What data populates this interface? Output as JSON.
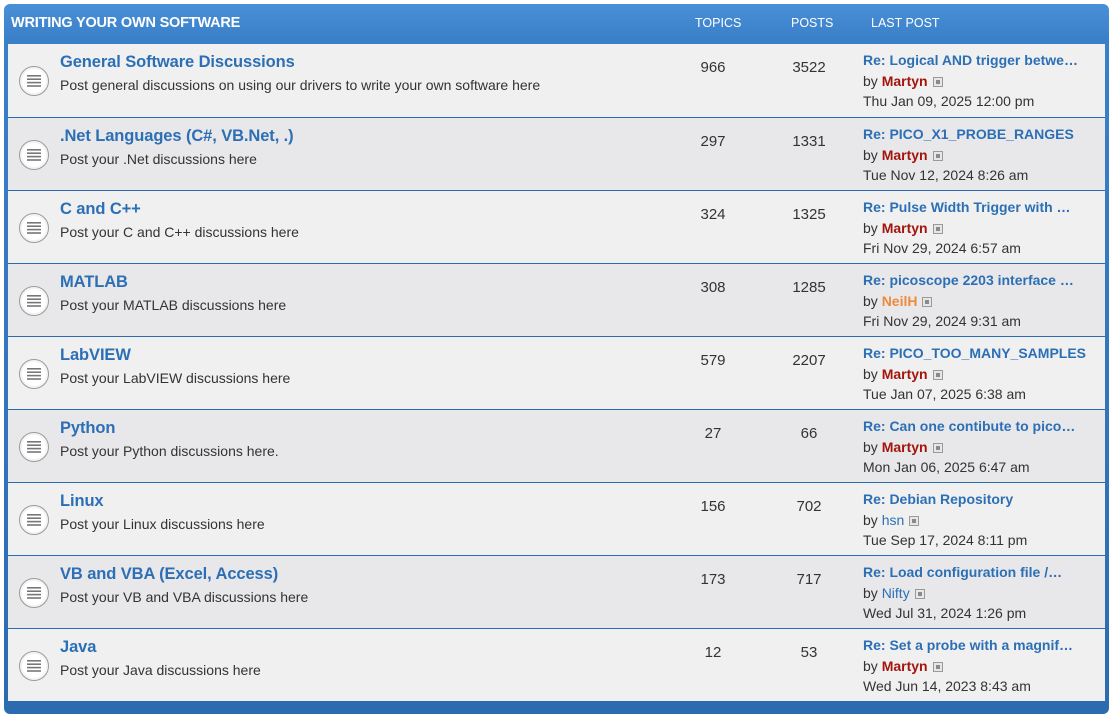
{
  "header": {
    "title": "WRITING YOUR OWN SOFTWARE",
    "topics_label": "TOPICS",
    "posts_label": "POSTS",
    "last_post_label": "LAST POST"
  },
  "colors": {
    "header_blue": "#3a80c8",
    "link_blue": "#2c6fb5",
    "user_red": "#a3150c",
    "user_orange": "#ef8a3a"
  },
  "icons": {
    "forum": "forum-read-icon",
    "view_post": "view-latest-post-icon"
  },
  "forums": [
    {
      "title": "General Software Discussions",
      "description": "Post general discussions on using our drivers to write your own software here",
      "topics": "966",
      "posts": "3522",
      "last_post": {
        "title": "Re: Logical AND trigger betwe…",
        "by": "by",
        "user": "Martyn",
        "user_color": "#a3150c",
        "time": "Thu Jan 09, 2025 12:00 pm"
      }
    },
    {
      "title": ".Net Languages (C#, VB.Net, .)",
      "description": "Post your .Net discussions here",
      "topics": "297",
      "posts": "1331",
      "last_post": {
        "title": "Re: PICO_X1_PROBE_RANGES",
        "by": "by",
        "user": "Martyn",
        "user_color": "#a3150c",
        "time": "Tue Nov 12, 2024 8:26 am"
      }
    },
    {
      "title": "C and C++",
      "description": "Post your C and C++ discussions here",
      "topics": "324",
      "posts": "1325",
      "last_post": {
        "title": "Re: Pulse Width Trigger with …",
        "by": "by",
        "user": "Martyn",
        "user_color": "#a3150c",
        "time": "Fri Nov 29, 2024 6:57 am"
      }
    },
    {
      "title": "MATLAB",
      "description": "Post your MATLAB discussions here",
      "topics": "308",
      "posts": "1285",
      "last_post": {
        "title": "Re: picoscope 2203 interface …",
        "by": "by",
        "user": "NeilH",
        "user_color": "#ef8a3a",
        "time": "Fri Nov 29, 2024 9:31 am"
      }
    },
    {
      "title": "LabVIEW",
      "description": "Post your LabVIEW discussions here",
      "topics": "579",
      "posts": "2207",
      "last_post": {
        "title": "Re: PICO_TOO_MANY_SAMPLES",
        "by": "by",
        "user": "Martyn",
        "user_color": "#a3150c",
        "time": "Tue Jan 07, 2025 6:38 am"
      }
    },
    {
      "title": "Python",
      "description": "Post your Python discussions here.",
      "topics": "27",
      "posts": "66",
      "last_post": {
        "title": "Re: Can one contibute to pico…",
        "by": "by",
        "user": "Martyn",
        "user_color": "#a3150c",
        "time": "Mon Jan 06, 2025 6:47 am"
      }
    },
    {
      "title": "Linux",
      "description": "Post your Linux discussions here",
      "topics": "156",
      "posts": "702",
      "last_post": {
        "title": "Re: Debian Repository",
        "by": "by",
        "user": "hsn",
        "user_color": "#2c6fb5",
        "time": "Tue Sep 17, 2024 8:11 pm"
      }
    },
    {
      "title": "VB and VBA (Excel, Access)",
      "description": "Post your VB and VBA discussions here",
      "topics": "173",
      "posts": "717",
      "last_post": {
        "title": "Re: Load configuration file /…",
        "by": "by",
        "user": "Nifty",
        "user_color": "#2c6fb5",
        "time": "Wed Jul 31, 2024 1:26 pm"
      }
    },
    {
      "title": "Java",
      "description": "Post your Java discussions here",
      "topics": "12",
      "posts": "53",
      "last_post": {
        "title": "Re: Set a probe with a magnif…",
        "by": "by",
        "user": "Martyn",
        "user_color": "#a3150c",
        "time": "Wed Jun 14, 2023 8:43 am"
      }
    }
  ]
}
